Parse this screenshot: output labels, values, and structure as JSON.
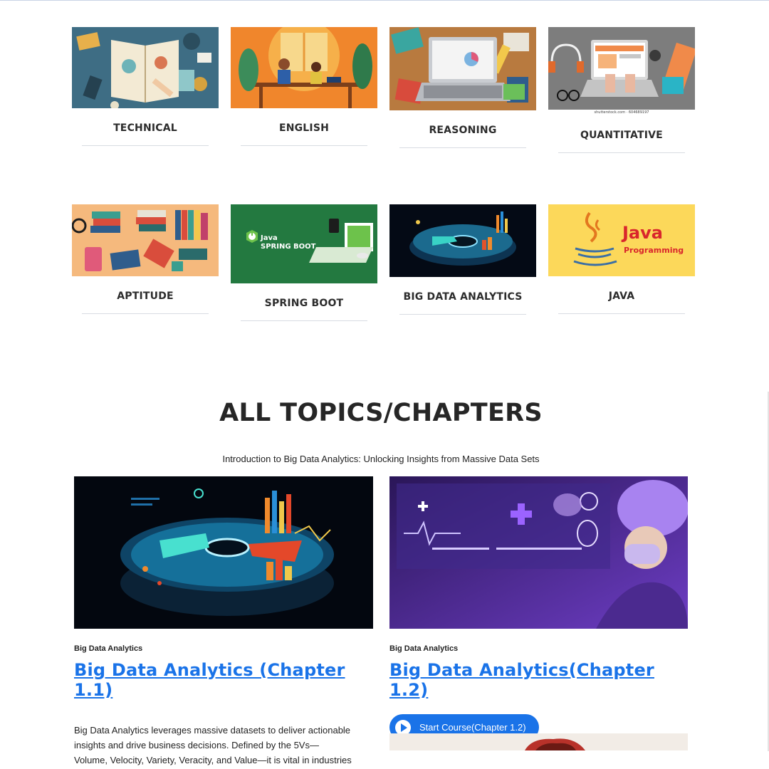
{
  "categories": [
    {
      "label": "TECHNICAL"
    },
    {
      "label": "ENGLISH"
    },
    {
      "label": "REASONING"
    },
    {
      "label": "QUANTITATIVE"
    },
    {
      "label": "APTITUDE"
    },
    {
      "label": "SPRING BOOT"
    },
    {
      "label": "BIG DATA ANALYTICS"
    },
    {
      "label": "JAVA"
    }
  ],
  "banner_text": {
    "spring_java": "Java",
    "spring_boot": "SPRING BOOT",
    "java_title": "Java",
    "java_sub": "Programming",
    "shutterstock": "shutterstock.com · 604689197"
  },
  "section": {
    "title": "ALL TOPICS/CHAPTERS",
    "subtitle": "Introduction to Big Data Analytics: Unlocking Insights from Massive Data Sets"
  },
  "courses": [
    {
      "category": "Big Data Analytics",
      "title": "Big Data Analytics (Chapter 1.1)",
      "description": "Big Data Analytics leverages massive datasets to deliver actionable insights and drive business decisions. Defined by the 5Vs—Volume, Velocity, Variety, Veracity, and Value—it is vital in industries like"
    },
    {
      "category": "Big Data Analytics",
      "title": "Big Data Analytics(Chapter 1.2)",
      "button": "Start Course(Chapter 1.2)"
    }
  ],
  "colors": {
    "link": "#1a73e8",
    "button_bg": "#1a73e8",
    "heading": "#262626"
  }
}
